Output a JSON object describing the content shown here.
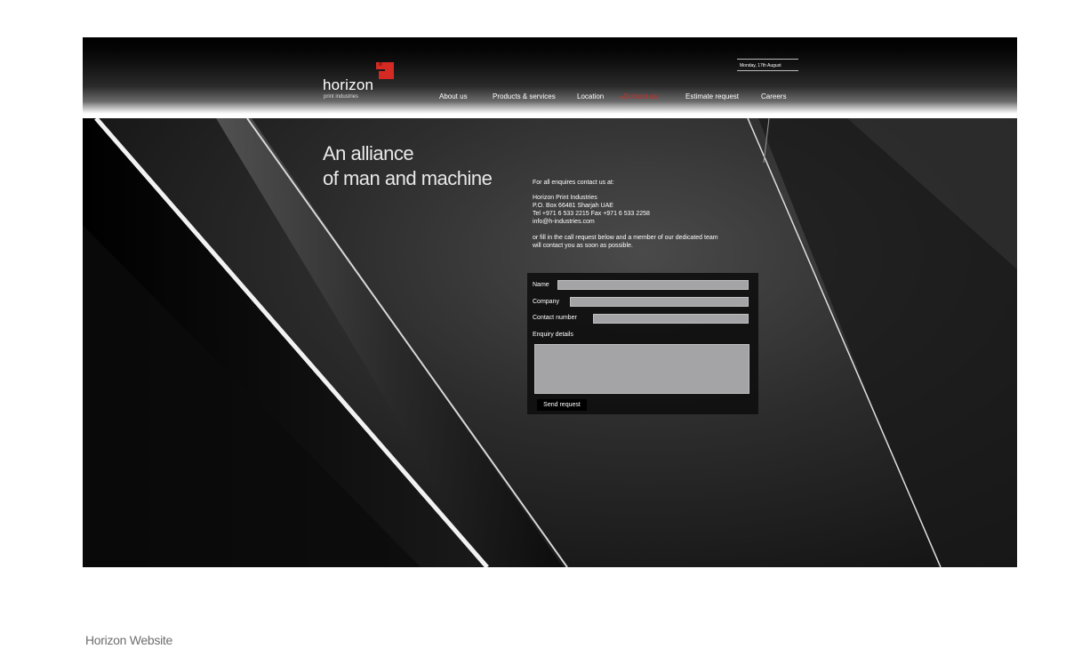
{
  "site": {
    "logo_text": "horizon",
    "logo_subtext": "print industries",
    "date": "Monday, 17th August",
    "accent": "#d52a24"
  },
  "nav": {
    "items": [
      {
        "label": "About us"
      },
      {
        "label": "Products & services"
      },
      {
        "label": "Location"
      },
      {
        "label": "Contact us",
        "active": true
      },
      {
        "label": "Estimate request"
      },
      {
        "label": "Careers"
      }
    ]
  },
  "hero": {
    "tagline_line1": "An alliance",
    "tagline_line2": "of man and machine"
  },
  "contact": {
    "intro": "For all enquires contact us at:",
    "company": "Horizon Print Industries",
    "address": "P.O. Box 66481 Sharjah UAE",
    "phones": "Tel +971 6 533 2215   Fax +971 6 533 2258",
    "email": "info@h-industries.com",
    "note_line1": "or fill in the call request below and a member of our dedicated team",
    "note_line2": "will contact you as soon as possible."
  },
  "form": {
    "name_label": "Name",
    "name_value": "",
    "company_label": "Company",
    "company_value": "",
    "contact_label": "Contact number",
    "contact_value": "",
    "enquiry_label": "Enquiry details",
    "enquiry_value": "",
    "send_label": "Send request"
  },
  "caption": "Horizon Website"
}
